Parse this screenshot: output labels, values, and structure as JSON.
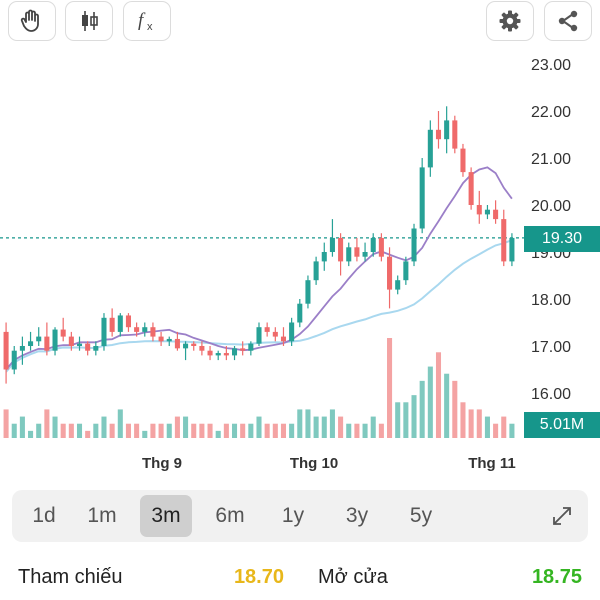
{
  "toolbar": {
    "left_icons": [
      "hand-icon",
      "candlestick-icon",
      "function-icon"
    ],
    "right_icons": [
      "gear-icon",
      "share-icon"
    ]
  },
  "chart_data": {
    "type": "candlestick",
    "price_axis": {
      "ticks": [
        "23.00",
        "22.00",
        "21.00",
        "20.00",
        "19.00",
        "18.00",
        "17.00",
        "16.00"
      ],
      "values": [
        23,
        22,
        21,
        20,
        19,
        18,
        17,
        16
      ],
      "range": [
        15.2,
        23.4
      ]
    },
    "x_axis": {
      "ticks": [
        "Thg 9",
        "Thg 10",
        "Thg 11"
      ]
    },
    "current_price": "19.30",
    "current_price_value": 19.3,
    "current_volume": "5.01M",
    "colors": {
      "up": "#27a196",
      "down": "#ef6a6a",
      "ma_short": "#9b7fc8",
      "ma_long": "#a9d8ef",
      "price_line": "#16968b"
    },
    "candles": [
      [
        17.3,
        17.5,
        16.2,
        16.5
      ],
      [
        16.5,
        17.0,
        16.4,
        16.9
      ],
      [
        16.9,
        17.2,
        16.6,
        17.0
      ],
      [
        17.0,
        17.3,
        16.9,
        17.1
      ],
      [
        17.1,
        17.4,
        17.0,
        17.2
      ],
      [
        17.2,
        17.5,
        16.8,
        16.9
      ],
      [
        16.9,
        17.4,
        16.8,
        17.35
      ],
      [
        17.35,
        17.6,
        17.1,
        17.2
      ],
      [
        17.2,
        17.3,
        16.9,
        17.0
      ],
      [
        17.0,
        17.2,
        16.9,
        17.05
      ],
      [
        17.05,
        17.1,
        16.8,
        16.9
      ],
      [
        16.9,
        17.1,
        16.8,
        17.0
      ],
      [
        17.0,
        17.7,
        16.9,
        17.6
      ],
      [
        17.6,
        17.8,
        17.2,
        17.3
      ],
      [
        17.3,
        17.7,
        17.2,
        17.65
      ],
      [
        17.65,
        17.7,
        17.3,
        17.4
      ],
      [
        17.4,
        17.5,
        17.2,
        17.3
      ],
      [
        17.3,
        17.5,
        17.2,
        17.4
      ],
      [
        17.4,
        17.5,
        17.1,
        17.2
      ],
      [
        17.2,
        17.3,
        17.0,
        17.1
      ],
      [
        17.1,
        17.2,
        17.0,
        17.15
      ],
      [
        17.15,
        17.3,
        16.9,
        16.95
      ],
      [
        16.95,
        17.1,
        16.7,
        17.05
      ],
      [
        17.05,
        17.1,
        16.9,
        17.0
      ],
      [
        17.0,
        17.1,
        16.8,
        16.9
      ],
      [
        16.9,
        17.0,
        16.7,
        16.8
      ],
      [
        16.8,
        16.9,
        16.7,
        16.85
      ],
      [
        16.85,
        17.0,
        16.7,
        16.8
      ],
      [
        16.8,
        17.0,
        16.7,
        16.95
      ],
      [
        16.95,
        17.1,
        16.8,
        16.9
      ],
      [
        16.9,
        17.1,
        16.8,
        17.05
      ],
      [
        17.05,
        17.5,
        17.0,
        17.4
      ],
      [
        17.4,
        17.5,
        17.2,
        17.3
      ],
      [
        17.3,
        17.4,
        17.1,
        17.2
      ],
      [
        17.2,
        17.4,
        17.0,
        17.1
      ],
      [
        17.1,
        17.6,
        17.0,
        17.5
      ],
      [
        17.5,
        18.0,
        17.4,
        17.9
      ],
      [
        17.9,
        18.5,
        17.8,
        18.4
      ],
      [
        18.4,
        18.9,
        18.3,
        18.8
      ],
      [
        18.8,
        19.2,
        18.6,
        19.0
      ],
      [
        19.0,
        19.7,
        18.9,
        19.3
      ],
      [
        19.3,
        19.4,
        18.5,
        18.8
      ],
      [
        18.8,
        19.2,
        18.7,
        19.1
      ],
      [
        19.1,
        19.3,
        18.8,
        18.9
      ],
      [
        18.9,
        19.2,
        18.8,
        19.0
      ],
      [
        19.0,
        19.4,
        18.9,
        19.3
      ],
      [
        19.3,
        19.4,
        18.8,
        18.9
      ],
      [
        18.9,
        19.1,
        17.8,
        18.2
      ],
      [
        18.2,
        18.5,
        18.1,
        18.4
      ],
      [
        18.4,
        18.9,
        18.3,
        18.8
      ],
      [
        18.8,
        19.6,
        18.7,
        19.5
      ],
      [
        19.5,
        21.0,
        19.4,
        20.8
      ],
      [
        20.8,
        21.8,
        20.6,
        21.6
      ],
      [
        21.6,
        22.0,
        21.2,
        21.4
      ],
      [
        21.4,
        22.1,
        21.1,
        21.8
      ],
      [
        21.8,
        21.9,
        21.1,
        21.2
      ],
      [
        21.2,
        21.3,
        20.6,
        20.7
      ],
      [
        20.7,
        20.8,
        19.9,
        20.0
      ],
      [
        20.0,
        20.3,
        19.6,
        19.8
      ],
      [
        19.8,
        20.0,
        19.7,
        19.9
      ],
      [
        19.9,
        20.1,
        19.6,
        19.7
      ],
      [
        19.7,
        19.9,
        18.7,
        18.8
      ],
      [
        18.8,
        19.4,
        18.7,
        19.3
      ]
    ],
    "volumes": [
      4,
      2,
      3,
      1,
      2,
      4,
      3,
      2,
      2,
      2,
      1,
      2,
      3,
      2,
      4,
      2,
      2,
      1,
      2,
      2,
      2,
      3,
      3,
      2,
      2,
      2,
      1,
      2,
      2,
      2,
      2,
      3,
      2,
      2,
      2,
      2,
      4,
      4,
      3,
      3,
      4,
      3,
      2,
      2,
      2,
      3,
      2,
      14,
      5,
      5,
      6,
      8,
      10,
      12,
      9,
      8,
      5,
      4,
      4,
      3,
      2,
      3,
      2
    ]
  },
  "range_tabs": {
    "items": [
      "1d",
      "1m",
      "3m",
      "6m",
      "1y",
      "3y",
      "5y"
    ],
    "active": "3m"
  },
  "info": {
    "ref_label": "Tham chiếu",
    "ref_value": "18.70",
    "ref_color": "#e8b71a",
    "open_label": "Mở cửa",
    "open_value": "18.75",
    "open_color": "#35b522"
  }
}
